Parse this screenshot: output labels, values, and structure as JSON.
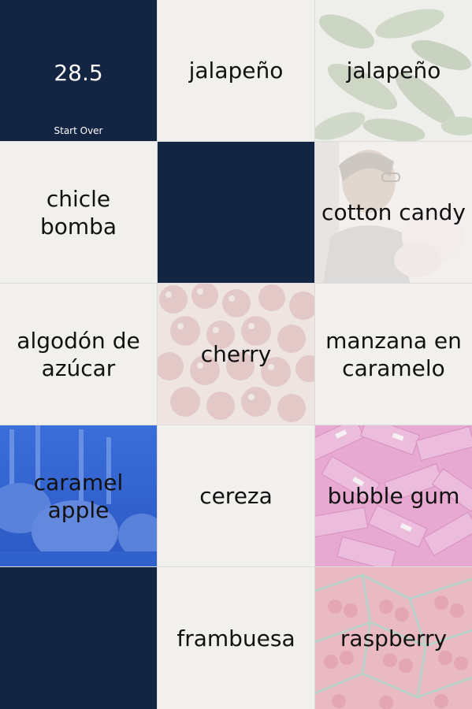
{
  "timer": {
    "value": "28.5",
    "start_over_label": "Start Over"
  },
  "tiles": {
    "r0c1": "jalapeño",
    "r0c2": "jalapeño",
    "r1c0": "chicle bomba",
    "r1c2": "cotton candy",
    "r2c0": "algodón de azúcar",
    "r2c1": "cherry",
    "r2c2": "manzana en caramelo",
    "r3c0": "caramel apple",
    "r3c1": "cereza",
    "r3c2": "bubble gum",
    "r4c1": "frambuesa",
    "r4c2": "raspberry"
  },
  "photos": {
    "r0c2": "jalapeno-peppers-photo",
    "r1c2": "boy-with-cotton-candy-photo",
    "r2c1": "cherries-photo",
    "r3c0": "caramel-apples-photo",
    "r3c2": "bubble-gum-packs-photo",
    "r4c2": "raspberries-photo"
  },
  "colors": {
    "tile_dark": "#132543",
    "tile_light": "#f2f0ec",
    "text": "#111111"
  }
}
